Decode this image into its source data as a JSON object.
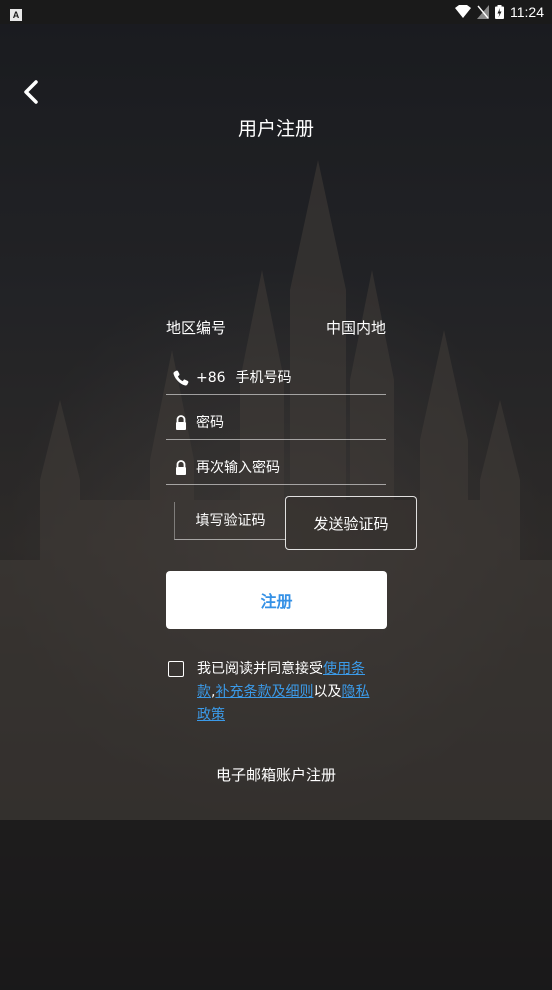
{
  "status_bar": {
    "app_badge": "A",
    "time": "11:24"
  },
  "header": {
    "title": "用户注册"
  },
  "form": {
    "region_label": "地区编号",
    "region_value": "中国内地",
    "phone_prefix": "+86",
    "phone_placeholder": "手机号码",
    "password_placeholder": "密码",
    "confirm_password_placeholder": "再次输入密码",
    "code_placeholder": "填写验证码",
    "send_code_label": "发送验证码",
    "register_label": "注册"
  },
  "agreement": {
    "text_before": "我已阅读并同意接受",
    "link_terms": "使用条款",
    "sep1": ",",
    "link_supplement": "补充条款及细则",
    "text_middle": "以及",
    "link_privacy": "隐私政策",
    "checked": false
  },
  "footer": {
    "email_register_label": "电子邮箱账户注册"
  },
  "colors": {
    "accent": "#3591e6",
    "link": "#3b9ae8"
  },
  "icons": {
    "back": "chevron-left-icon",
    "phone": "phone-icon",
    "lock": "lock-icon"
  }
}
